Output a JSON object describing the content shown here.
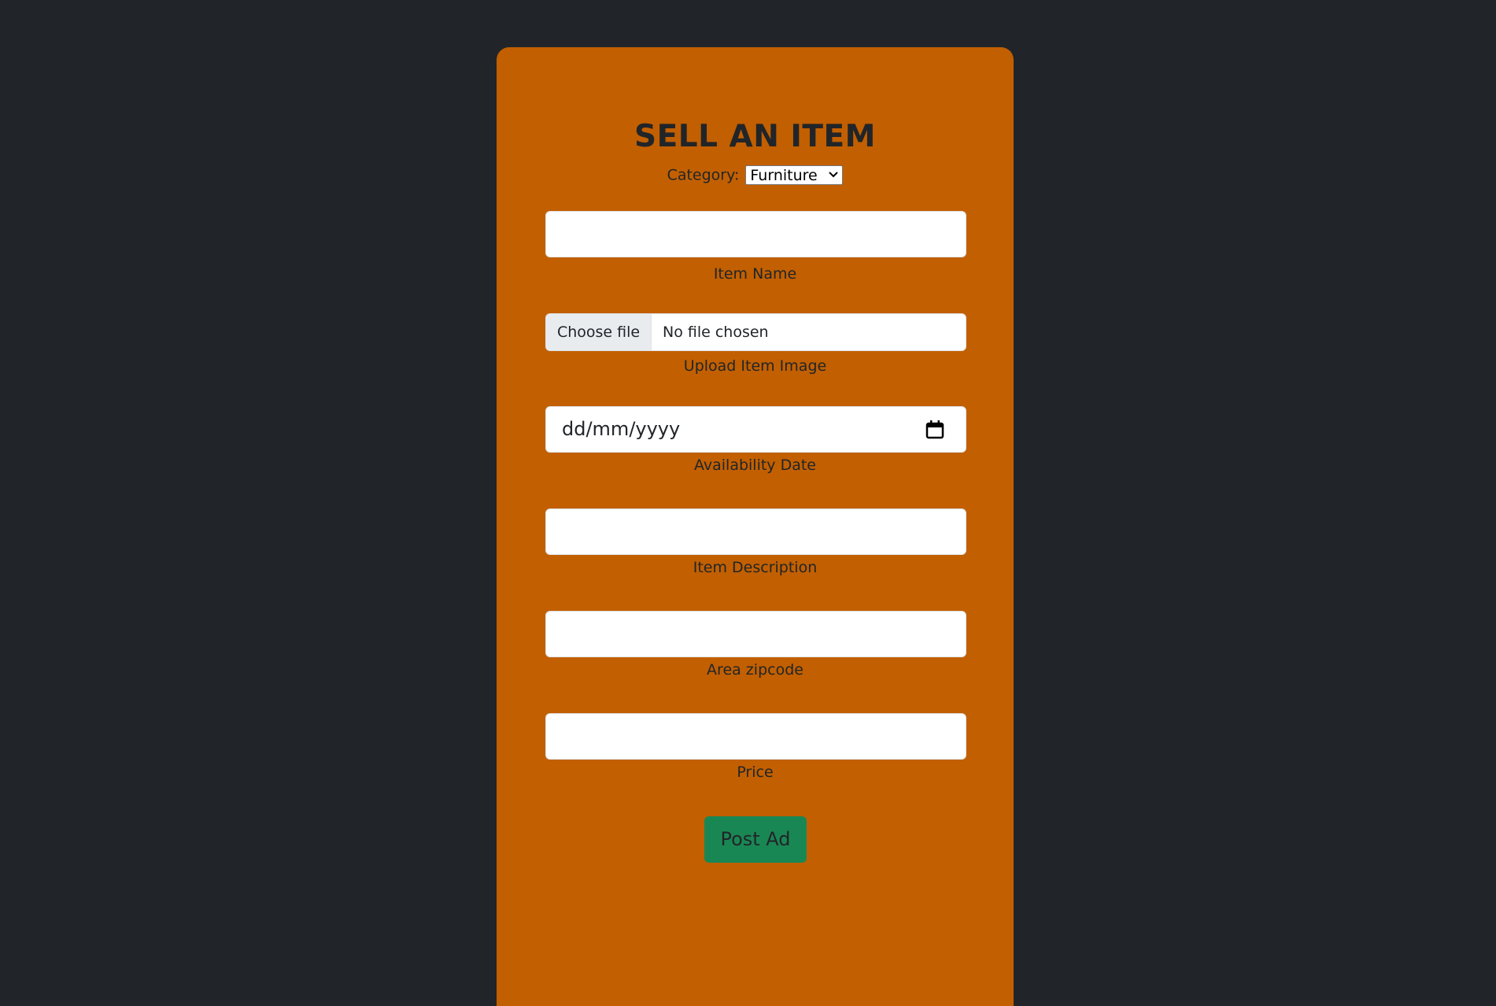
{
  "form": {
    "title": "SELL AN ITEM",
    "category_label": "Category:",
    "category_selected": "Furniture",
    "item_name": {
      "value": "",
      "label": "Item Name"
    },
    "item_image": {
      "button_label": "Choose file",
      "status": "No file chosen",
      "label": "Upload Item Image"
    },
    "availability_date": {
      "placeholder": "dd/mm/yyyy",
      "label": "Availability Date"
    },
    "item_description": {
      "value": "",
      "label": "Item Description"
    },
    "area_zipcode": {
      "value": "",
      "label": "Area zipcode"
    },
    "price": {
      "value": "",
      "label": "Price"
    },
    "submit_label": "Post Ad"
  },
  "colors": {
    "page_background": "#212529",
    "card_background": "#c25f00",
    "submit_background": "#198754"
  }
}
